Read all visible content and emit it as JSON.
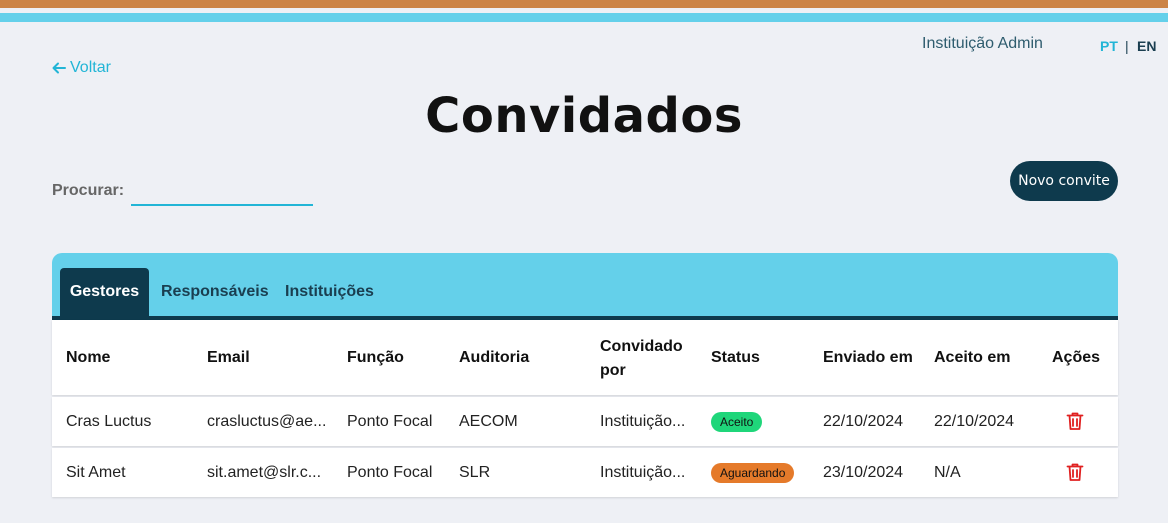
{
  "header": {
    "user_label": "Instituição Admin",
    "lang_pt": "PT",
    "lang_sep": "|",
    "lang_en": "EN"
  },
  "nav": {
    "back_label": "Voltar"
  },
  "page": {
    "title": "Convidados"
  },
  "search": {
    "label": "Procurar:",
    "value": "",
    "placeholder": ""
  },
  "actions": {
    "new_invite_label": "Novo convite"
  },
  "tabs": [
    {
      "label": "Gestores",
      "active": true
    },
    {
      "label": "Responsáveis",
      "active": false
    },
    {
      "label": "Instituições",
      "active": false
    }
  ],
  "table": {
    "columns": {
      "name": "Nome",
      "email": "Email",
      "role": "Função",
      "audit": "Auditoria",
      "invited_by": "Convidado por",
      "status": "Status",
      "sent_at": "Enviado em",
      "accepted_at": "Aceito em",
      "actions": "Ações"
    },
    "rows": [
      {
        "name": "Cras Luctus",
        "email": "crasluctus@ae...",
        "role": "Ponto Focal",
        "audit": "AECOM",
        "invited_by": "Instituição...",
        "status": "Aceito",
        "sent_at": "22/10/2024",
        "accepted_at": "22/10/2024"
      },
      {
        "name": "Sit Amet",
        "email": "sit.amet@slr.c...",
        "role": "Ponto Focal",
        "audit": "SLR",
        "invited_by": "Instituição...",
        "status": "Aguardando",
        "sent_at": "23/10/2024",
        "accepted_at": "N/A"
      }
    ]
  },
  "colors": {
    "stripe_orange": "#cc8446",
    "stripe_blue": "#64d0ea",
    "dark_accent": "#0e3a4d",
    "link": "#22b5d6",
    "status_accepted": "#1fd67a",
    "status_waiting": "#e57a2a",
    "delete": "#e02020"
  },
  "icons": {
    "back": "arrow-left-icon",
    "delete": "trash-icon"
  }
}
